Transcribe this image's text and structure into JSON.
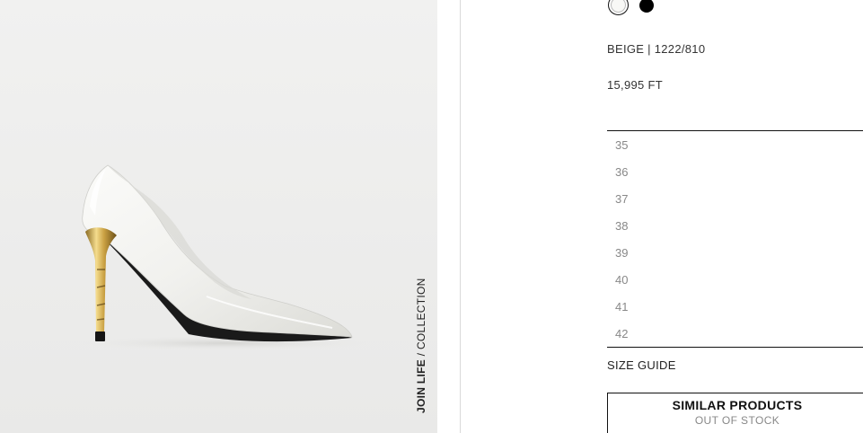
{
  "gallery": {
    "vertical_label_strong": "JOIN LIFE",
    "vertical_label_rest": " / COLLECTION"
  },
  "colors": {
    "selected": "white",
    "options": [
      "white",
      "black"
    ]
  },
  "product": {
    "color_ref": "BEIGE | 1222/810",
    "price": "15,995 FT"
  },
  "sizes": [
    "35",
    "36",
    "37",
    "38",
    "39",
    "40",
    "41",
    "42"
  ],
  "size_guide": "SIZE GUIDE",
  "similar": {
    "title": "SIMILAR PRODUCTS",
    "subtitle": "OUT OF STOCK"
  }
}
